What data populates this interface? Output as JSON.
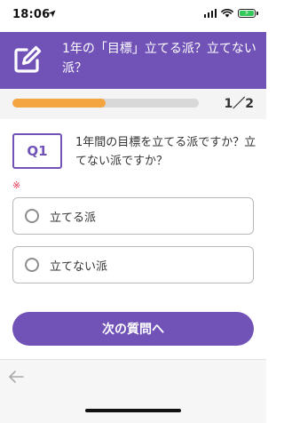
{
  "status_bar": {
    "time": "18:06",
    "icons": [
      "location-arrow-icon",
      "signal-icon",
      "wifi-icon",
      "battery-charging-icon"
    ]
  },
  "header": {
    "icon": "edit-icon",
    "title": "1年の「目標」立てる派？立てない派？"
  },
  "progress": {
    "fraction": 0.5,
    "text": "1／2",
    "fill_color": "#f5a540"
  },
  "question": {
    "badge": "Q1",
    "text": "1年間の目標を立てる派ですか？立てない派ですか？",
    "required_mark": "※"
  },
  "options": [
    {
      "label": "立てる派",
      "selected": false
    },
    {
      "label": "立てない派",
      "selected": false
    }
  ],
  "next_button": {
    "label": "次の質問へ"
  },
  "bottom_bar": {
    "icon": "back-arrow-icon"
  },
  "colors": {
    "brand": "#7153b8",
    "progress": "#f5a540",
    "required": "#e0304e"
  }
}
